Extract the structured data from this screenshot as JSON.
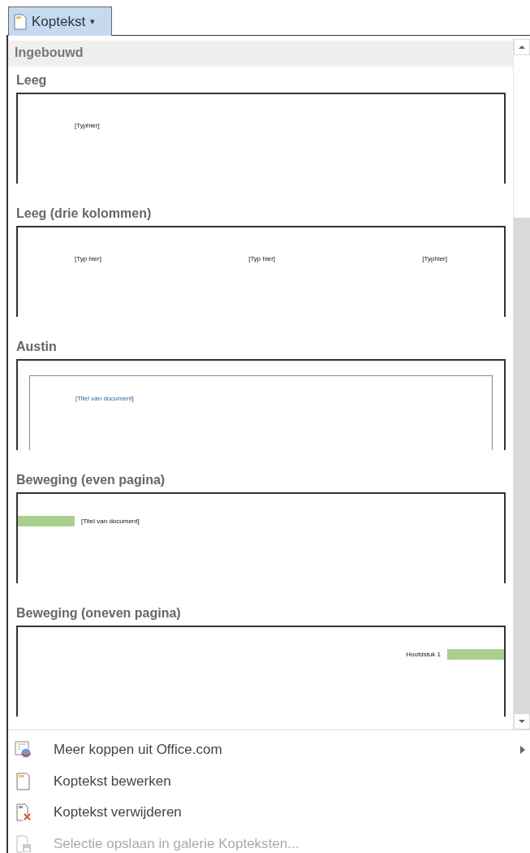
{
  "button": {
    "label": "Koptekst",
    "caret": "▾"
  },
  "gallery": {
    "section": "Ingebouwd",
    "items": [
      {
        "title": "Leeg",
        "kind": "blank",
        "texts": [
          "[Typhier]"
        ]
      },
      {
        "title": "Leeg (drie kolommen)",
        "kind": "three-column",
        "texts": [
          "[Typ hier]",
          "[Typ hier]",
          "[Typhier]"
        ]
      },
      {
        "title": "Austin",
        "kind": "austin",
        "texts": [
          "[Titel van document]"
        ]
      },
      {
        "title": "Beweging (even pagina)",
        "kind": "motion-even",
        "texts": [
          "[Titel van document]"
        ]
      },
      {
        "title": "Beweging (oneven pagina)",
        "kind": "motion-odd",
        "texts": [
          "Hoofdstuk 1"
        ]
      }
    ]
  },
  "menu": [
    {
      "label": "Meer koppen uit Office.com",
      "kind": "more",
      "submenu": true,
      "disabled": false
    },
    {
      "label": "Koptekst bewerken",
      "kind": "edit",
      "submenu": false,
      "disabled": false
    },
    {
      "label": "Koptekst verwijderen",
      "kind": "remove",
      "submenu": false,
      "disabled": false
    },
    {
      "label": "Selectie opslaan in galerie Kopteksten...",
      "kind": "save",
      "submenu": false,
      "disabled": true
    }
  ]
}
